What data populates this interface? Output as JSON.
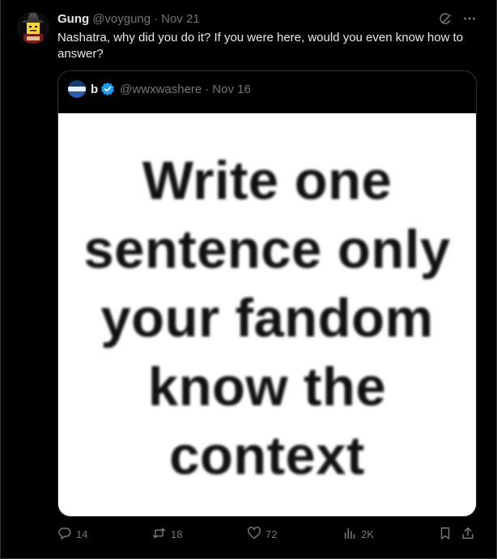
{
  "tweet": {
    "author_name": "Gung",
    "author_handle": "@voygung",
    "separator": "·",
    "date": "Nov 21",
    "text": "Nashatra, why did you do it? If you were here, would you even know how to answer?"
  },
  "quoted_tweet": {
    "author_name": "b",
    "author_handle": "@wwxwashere",
    "separator": "·",
    "date": "Nov 16",
    "verified": true,
    "image_text": "Write one\nsentence only\nyour fandom\nknow the\ncontext"
  },
  "actions": {
    "replies": "14",
    "reposts": "18",
    "likes": "72",
    "views": "2K"
  },
  "colors": {
    "background": "#000000",
    "text_primary": "#e7e9ea",
    "text_secondary": "#71767b",
    "border": "#2f3336",
    "verified": "#1d9bf0"
  },
  "icons": [
    "grok-icon",
    "more-icon",
    "reply-icon",
    "repost-icon",
    "like-icon",
    "views-icon",
    "bookmark-icon",
    "share-icon",
    "verified-badge-icon"
  ]
}
